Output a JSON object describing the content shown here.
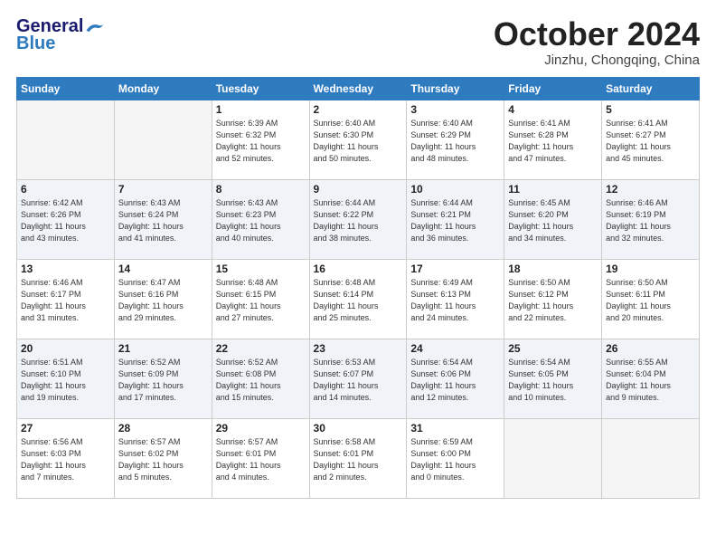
{
  "header": {
    "logo_general": "General",
    "logo_blue": "Blue",
    "month": "October 2024",
    "location": "Jinzhu, Chongqing, China"
  },
  "weekdays": [
    "Sunday",
    "Monday",
    "Tuesday",
    "Wednesday",
    "Thursday",
    "Friday",
    "Saturday"
  ],
  "weeks": [
    [
      {
        "day": "",
        "info": ""
      },
      {
        "day": "",
        "info": ""
      },
      {
        "day": "1",
        "info": "Sunrise: 6:39 AM\nSunset: 6:32 PM\nDaylight: 11 hours\nand 52 minutes."
      },
      {
        "day": "2",
        "info": "Sunrise: 6:40 AM\nSunset: 6:30 PM\nDaylight: 11 hours\nand 50 minutes."
      },
      {
        "day": "3",
        "info": "Sunrise: 6:40 AM\nSunset: 6:29 PM\nDaylight: 11 hours\nand 48 minutes."
      },
      {
        "day": "4",
        "info": "Sunrise: 6:41 AM\nSunset: 6:28 PM\nDaylight: 11 hours\nand 47 minutes."
      },
      {
        "day": "5",
        "info": "Sunrise: 6:41 AM\nSunset: 6:27 PM\nDaylight: 11 hours\nand 45 minutes."
      }
    ],
    [
      {
        "day": "6",
        "info": "Sunrise: 6:42 AM\nSunset: 6:26 PM\nDaylight: 11 hours\nand 43 minutes."
      },
      {
        "day": "7",
        "info": "Sunrise: 6:43 AM\nSunset: 6:24 PM\nDaylight: 11 hours\nand 41 minutes."
      },
      {
        "day": "8",
        "info": "Sunrise: 6:43 AM\nSunset: 6:23 PM\nDaylight: 11 hours\nand 40 minutes."
      },
      {
        "day": "9",
        "info": "Sunrise: 6:44 AM\nSunset: 6:22 PM\nDaylight: 11 hours\nand 38 minutes."
      },
      {
        "day": "10",
        "info": "Sunrise: 6:44 AM\nSunset: 6:21 PM\nDaylight: 11 hours\nand 36 minutes."
      },
      {
        "day": "11",
        "info": "Sunrise: 6:45 AM\nSunset: 6:20 PM\nDaylight: 11 hours\nand 34 minutes."
      },
      {
        "day": "12",
        "info": "Sunrise: 6:46 AM\nSunset: 6:19 PM\nDaylight: 11 hours\nand 32 minutes."
      }
    ],
    [
      {
        "day": "13",
        "info": "Sunrise: 6:46 AM\nSunset: 6:17 PM\nDaylight: 11 hours\nand 31 minutes."
      },
      {
        "day": "14",
        "info": "Sunrise: 6:47 AM\nSunset: 6:16 PM\nDaylight: 11 hours\nand 29 minutes."
      },
      {
        "day": "15",
        "info": "Sunrise: 6:48 AM\nSunset: 6:15 PM\nDaylight: 11 hours\nand 27 minutes."
      },
      {
        "day": "16",
        "info": "Sunrise: 6:48 AM\nSunset: 6:14 PM\nDaylight: 11 hours\nand 25 minutes."
      },
      {
        "day": "17",
        "info": "Sunrise: 6:49 AM\nSunset: 6:13 PM\nDaylight: 11 hours\nand 24 minutes."
      },
      {
        "day": "18",
        "info": "Sunrise: 6:50 AM\nSunset: 6:12 PM\nDaylight: 11 hours\nand 22 minutes."
      },
      {
        "day": "19",
        "info": "Sunrise: 6:50 AM\nSunset: 6:11 PM\nDaylight: 11 hours\nand 20 minutes."
      }
    ],
    [
      {
        "day": "20",
        "info": "Sunrise: 6:51 AM\nSunset: 6:10 PM\nDaylight: 11 hours\nand 19 minutes."
      },
      {
        "day": "21",
        "info": "Sunrise: 6:52 AM\nSunset: 6:09 PM\nDaylight: 11 hours\nand 17 minutes."
      },
      {
        "day": "22",
        "info": "Sunrise: 6:52 AM\nSunset: 6:08 PM\nDaylight: 11 hours\nand 15 minutes."
      },
      {
        "day": "23",
        "info": "Sunrise: 6:53 AM\nSunset: 6:07 PM\nDaylight: 11 hours\nand 14 minutes."
      },
      {
        "day": "24",
        "info": "Sunrise: 6:54 AM\nSunset: 6:06 PM\nDaylight: 11 hours\nand 12 minutes."
      },
      {
        "day": "25",
        "info": "Sunrise: 6:54 AM\nSunset: 6:05 PM\nDaylight: 11 hours\nand 10 minutes."
      },
      {
        "day": "26",
        "info": "Sunrise: 6:55 AM\nSunset: 6:04 PM\nDaylight: 11 hours\nand 9 minutes."
      }
    ],
    [
      {
        "day": "27",
        "info": "Sunrise: 6:56 AM\nSunset: 6:03 PM\nDaylight: 11 hours\nand 7 minutes."
      },
      {
        "day": "28",
        "info": "Sunrise: 6:57 AM\nSunset: 6:02 PM\nDaylight: 11 hours\nand 5 minutes."
      },
      {
        "day": "29",
        "info": "Sunrise: 6:57 AM\nSunset: 6:01 PM\nDaylight: 11 hours\nand 4 minutes."
      },
      {
        "day": "30",
        "info": "Sunrise: 6:58 AM\nSunset: 6:01 PM\nDaylight: 11 hours\nand 2 minutes."
      },
      {
        "day": "31",
        "info": "Sunrise: 6:59 AM\nSunset: 6:00 PM\nDaylight: 11 hours\nand 0 minutes."
      },
      {
        "day": "",
        "info": ""
      },
      {
        "day": "",
        "info": ""
      }
    ]
  ]
}
